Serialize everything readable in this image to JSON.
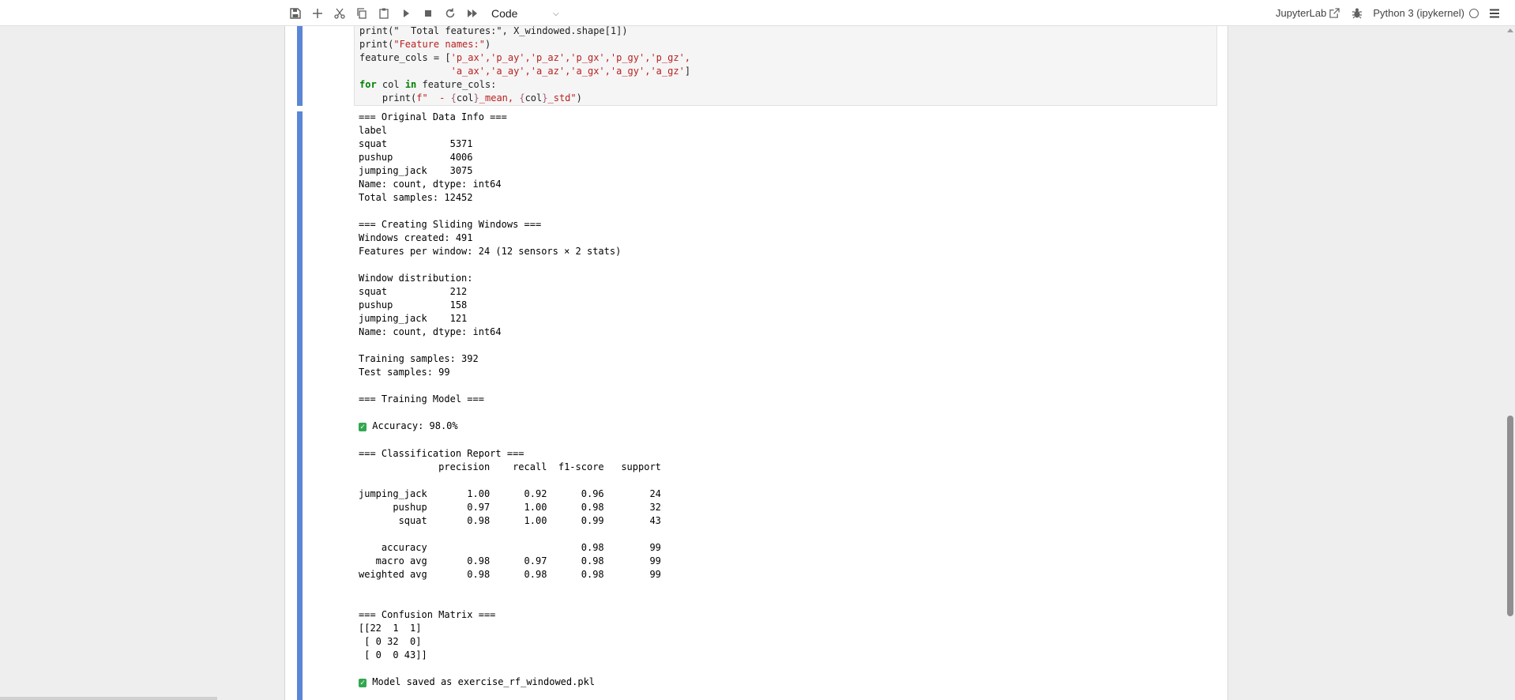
{
  "toolbar": {
    "cell_type": "Code",
    "jupyterlab_label": "JupyterLab",
    "kernel_name": "Python 3 (ipykernel)",
    "icons": [
      "save-icon",
      "add-cell-icon",
      "cut-icon",
      "copy-icon",
      "paste-icon",
      "run-icon",
      "stop-icon",
      "restart-icon",
      "run-all-icon"
    ]
  },
  "code_cell": {
    "lines": [
      {
        "segments": [
          {
            "t": "print(\"Feature names:\")",
            "c": "mix"
          }
        ]
      }
    ]
  },
  "code_lines": {
    "l0": "print(\"  Total features:\", X_windowed.shape[1])",
    "l1a": "print(",
    "l1b": "\"Feature names:\"",
    "l1c": ")",
    "l2a": "feature_cols = [",
    "l2b": "'p_ax','p_ay','p_az','p_gx','p_gy','p_gz',",
    "l3b": "'a_ax','a_ay','a_az','a_gx','a_gy','a_gz'",
    "l3c": "]",
    "l4a": "for",
    "l4b": " col ",
    "l4c": "in",
    "l4d": " feature_cols:",
    "l5a": "    print(",
    "l5b": "f\"  - ",
    "l5c": "{",
    "l5d": "col",
    "l5e": "}",
    "l5f": "_mean, ",
    "l5g": "{",
    "l5h": "col",
    "l5i": "}",
    "l5j": "_std\"",
    "l5k": ")"
  },
  "output": {
    "block1": "=== Original Data Info ===\nlabel\nsquat           5371\npushup          4006\njumping_jack    3075\nName: count, dtype: int64\nTotal samples: 12452\n\n=== Creating Sliding Windows ===\nWindows created: 491\nFeatures per window: 24 (12 sensors × 2 stats)\n\nWindow distribution:\nsquat           212\npushup          158\njumping_jack    121\nName: count, dtype: int64\n\nTraining samples: 392\nTest samples: 99\n\n=== Training Model ===\n",
    "check_icon": "✓",
    "accuracy_line": "Accuracy: 98.0%",
    "block2": "\n=== Classification Report ===\n              precision    recall  f1-score   support\n\njumping_jack       1.00      0.92      0.96        24\n      pushup       0.97      1.00      0.98        32\n       squat       0.98      1.00      0.99        43\n\n    accuracy                           0.98        99\n   macro avg       0.98      0.97      0.98        99\nweighted avg       0.98      0.98      0.98        99\n\n\n=== Confusion Matrix ===\n[[22  1  1]\n [ 0 32  0]\n [ 0  0 43]]\n",
    "saved_line": "Model saved as exercise_rf_windowed.pkl"
  },
  "colors": {
    "collapser": "#5b86d6",
    "keyword": "#008000",
    "string": "#ba2121",
    "check_badge": "#31a84f"
  }
}
